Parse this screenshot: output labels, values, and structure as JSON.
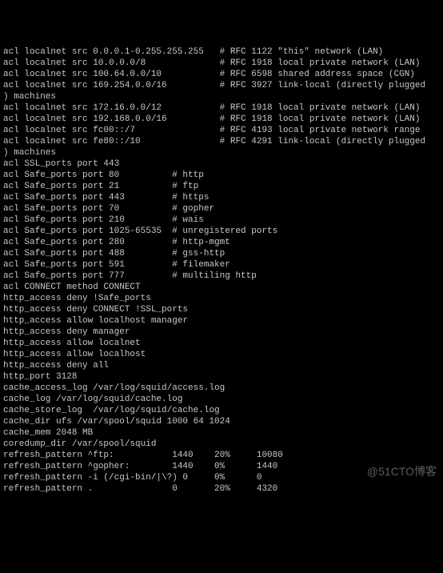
{
  "lines": [
    "acl localnet src 0.0.0.1-0.255.255.255   # RFC 1122 \"this\" network (LAN)",
    "acl localnet src 10.0.0.0/8              # RFC 1918 local private network (LAN)",
    "acl localnet src 100.64.0.0/10           # RFC 6598 shared address space (CGN)",
    "acl localnet src 169.254.0.0/16          # RFC 3927 link-local (directly plugged",
    ") machines",
    "acl localnet src 172.16.0.0/12           # RFC 1918 local private network (LAN)",
    "acl localnet src 192.168.0.0/16          # RFC 1918 local private network (LAN)",
    "acl localnet src fc00::/7                # RFC 4193 local private network range",
    "acl localnet src fe80::/10               # RFC 4291 link-local (directly plugged",
    ") machines",
    "acl SSL_ports port 443",
    "acl Safe_ports port 80          # http",
    "acl Safe_ports port 21          # ftp",
    "acl Safe_ports port 443         # https",
    "acl Safe_ports port 70          # gopher",
    "acl Safe_ports port 210         # wais",
    "acl Safe_ports port 1025-65535  # unregistered ports",
    "acl Safe_ports port 280         # http-mgmt",
    "acl Safe_ports port 488         # gss-http",
    "acl Safe_ports port 591         # filemaker",
    "acl Safe_ports port 777         # multiling http",
    "acl CONNECT method CONNECT",
    "http_access deny !Safe_ports",
    "http_access deny CONNECT !SSL_ports",
    "http_access allow localhost manager",
    "http_access deny manager",
    "http_access allow localnet",
    "http_access allow localhost",
    "http_access deny all",
    "http_port 3128",
    "cache_access_log /var/log/squid/access.log",
    "cache_log /var/log/squid/cache.log",
    "cache_store_log  /var/log/squid/cache.log",
    "cache_dir ufs /var/spool/squid 1000 64 1024",
    "cache_mem 2048 MB",
    "coredump_dir /var/spool/squid",
    "refresh_pattern ^ftp:           1440    20%     10080",
    "refresh_pattern ^gopher:        1440    0%      1440",
    "refresh_pattern -i (/cgi-bin/|\\?) 0     0%      0",
    "refresh_pattern .               0       20%     4320"
  ],
  "watermark": "@51CTO博客"
}
